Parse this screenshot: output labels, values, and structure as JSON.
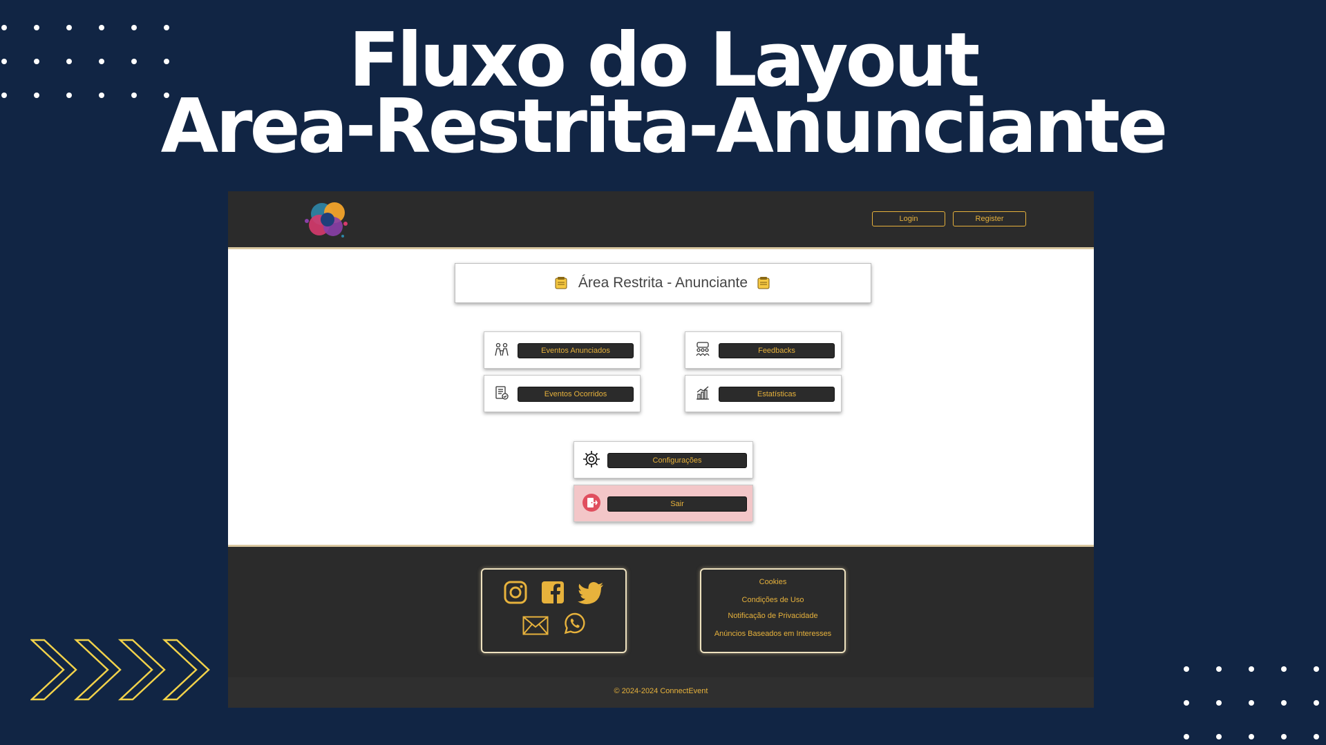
{
  "slide": {
    "title_line1": "Fluxo do Layout",
    "title_line2": "Area-Restrita-Anunciante"
  },
  "header": {
    "login_label": "Login",
    "register_label": "Register"
  },
  "main": {
    "title": "Área Restrita - Anunciante",
    "cards": {
      "eventos_anunciados": "Eventos Anunciados",
      "feedbacks": "Feedbacks",
      "eventos_ocorridos": "Eventos Ocorridos",
      "estatisticas": "Estatísticas",
      "configuracoes": "Configurações",
      "sair": "Sair"
    }
  },
  "footer": {
    "links": {
      "cookies": "Cookies",
      "condicoes": "Condições de Uso",
      "privacidade": "Notificação de Privacidade",
      "anuncios": "Anúncios Baseados em Interesses"
    },
    "social_icons": [
      "instagram-icon",
      "facebook-icon",
      "twitter-icon",
      "email-icon",
      "whatsapp-icon"
    ],
    "copyright": "© 2024-2024 ConnectEvent"
  },
  "colors": {
    "slide_bg": "#112544",
    "accent": "#e7b23c",
    "dark": "#2b2b2b",
    "exit_bg": "#f3c6c8"
  }
}
